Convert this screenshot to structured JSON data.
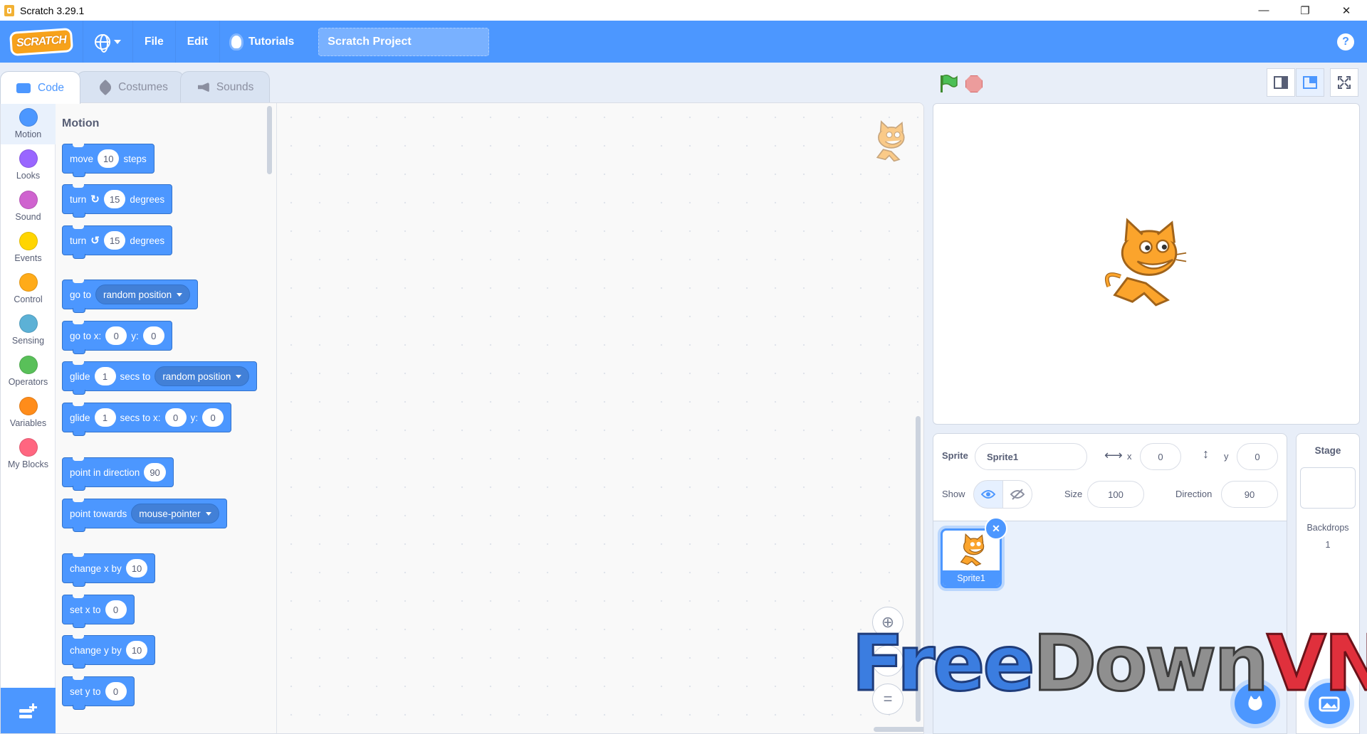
{
  "window": {
    "title": "Scratch 3.29.1",
    "minimize": "—",
    "restore": "❐",
    "close": "✕"
  },
  "menu": {
    "logo": "SCRATCH",
    "file": "File",
    "edit": "Edit",
    "tutorials": "Tutorials",
    "project_title": "Scratch Project",
    "help": "?"
  },
  "tabs": [
    {
      "label": "Code"
    },
    {
      "label": "Costumes"
    },
    {
      "label": "Sounds"
    }
  ],
  "categories": [
    {
      "label": "Motion",
      "color": "#4c97ff"
    },
    {
      "label": "Looks",
      "color": "#9966ff"
    },
    {
      "label": "Sound",
      "color": "#cf63cf"
    },
    {
      "label": "Events",
      "color": "#ffd500"
    },
    {
      "label": "Control",
      "color": "#ffab19"
    },
    {
      "label": "Sensing",
      "color": "#5cb1d6"
    },
    {
      "label": "Operators",
      "color": "#59c059"
    },
    {
      "label": "Variables",
      "color": "#ff8c1a"
    },
    {
      "label": "My Blocks",
      "color": "#ff6680"
    }
  ],
  "palette": {
    "heading": "Motion",
    "move": {
      "a": "move",
      "v": "10",
      "b": "steps"
    },
    "turn_right": {
      "a": "turn",
      "v": "15",
      "b": "degrees"
    },
    "turn_left": {
      "a": "turn",
      "v": "15",
      "b": "degrees"
    },
    "go_to": {
      "a": "go to",
      "dd": "random position"
    },
    "go_to_xy": {
      "a": "go to x:",
      "x": "0",
      "b": "y:",
      "y": "0"
    },
    "glide_to": {
      "a": "glide",
      "v": "1",
      "b": "secs to",
      "dd": "random position"
    },
    "glide_xy": {
      "a": "glide",
      "v": "1",
      "b": "secs to x:",
      "x": "0",
      "c": "y:",
      "y": "0"
    },
    "point_dir": {
      "a": "point in direction",
      "v": "90"
    },
    "point_towards": {
      "a": "point towards",
      "dd": "mouse-pointer"
    },
    "change_x": {
      "a": "change x by",
      "v": "10"
    },
    "set_x": {
      "a": "set x to",
      "v": "0"
    },
    "change_y": {
      "a": "change y by",
      "v": "10"
    },
    "set_y": {
      "a": "set y to",
      "v": "0"
    }
  },
  "sprite_info": {
    "sprite_label": "Sprite",
    "sprite_name": "Sprite1",
    "x_label": "x",
    "x": "0",
    "y_label": "y",
    "y": "0",
    "show_label": "Show",
    "size_label": "Size",
    "size": "100",
    "direction_label": "Direction",
    "direction": "90"
  },
  "sprites": [
    {
      "name": "Sprite1"
    }
  ],
  "stage_pane": {
    "title": "Stage",
    "backdrops_label": "Backdrops",
    "backdrops_count": "1"
  },
  "watermark": {
    "part1": "Free",
    "part2": "Down",
    "part3": "VN"
  }
}
